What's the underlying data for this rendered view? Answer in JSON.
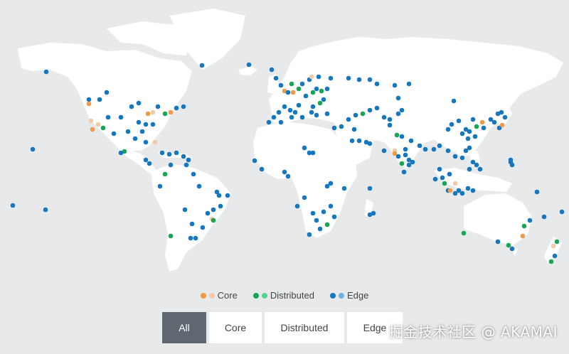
{
  "map": {
    "land_color": "#ffffff",
    "ocean_color": "#e8e9eb",
    "colors": {
      "core": [
        "#f09a4a",
        "#f4c9a7"
      ],
      "distributed": [
        "#1aa552",
        "#55d68e"
      ],
      "edge": [
        "#1577bf",
        "#6fb1e0"
      ]
    }
  },
  "legend": {
    "core": "Core",
    "distributed": "Distributed",
    "edge": "Edge"
  },
  "tabs": [
    {
      "label": "All",
      "active": true
    },
    {
      "label": "Core",
      "active": false
    },
    {
      "label": "Distributed",
      "active": false
    },
    {
      "label": "Edge",
      "active": false
    }
  ],
  "watermark": "掘金技术社区 @ AKAMAI"
}
